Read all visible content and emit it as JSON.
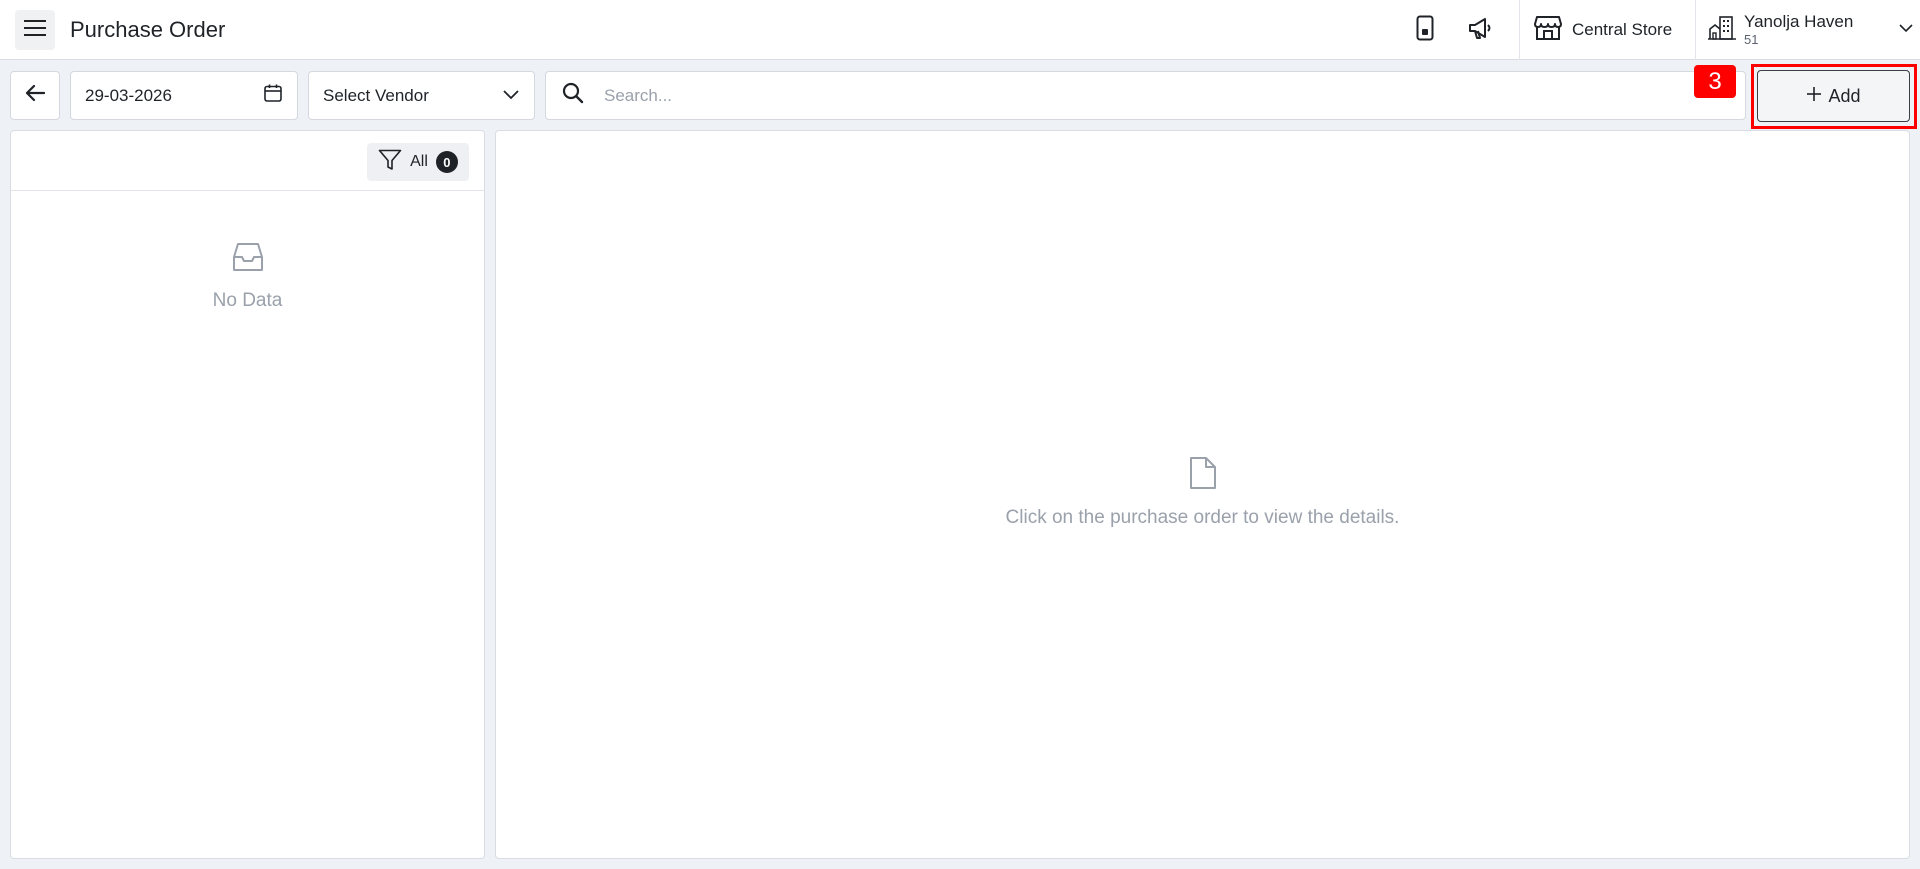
{
  "header": {
    "title": "Purchase Order",
    "store_name": "Central Store",
    "property_name": "Yanolja Haven",
    "property_number": "51"
  },
  "toolbar": {
    "date_value": "29-03-2026",
    "vendor_select_label": "Select Vendor",
    "search_placeholder": "Search...",
    "add_label": "Add",
    "step_marker": "3"
  },
  "list_panel": {
    "filter_label": "All",
    "filter_count": "0",
    "empty_text": "No Data"
  },
  "detail_panel": {
    "empty_text": "Click on the purchase order to view the details."
  },
  "colors": {
    "highlight": "#ff0000",
    "muted_text": "#9aa1ab",
    "dark": "#1f2328"
  },
  "icons": [
    "menu-icon",
    "mobile-icon",
    "megaphone-icon",
    "store-icon",
    "building-icon",
    "chevron-down-icon",
    "arrow-left-icon",
    "calendar-icon",
    "search-icon",
    "plus-icon",
    "filter-icon",
    "inbox-icon",
    "document-icon"
  ]
}
